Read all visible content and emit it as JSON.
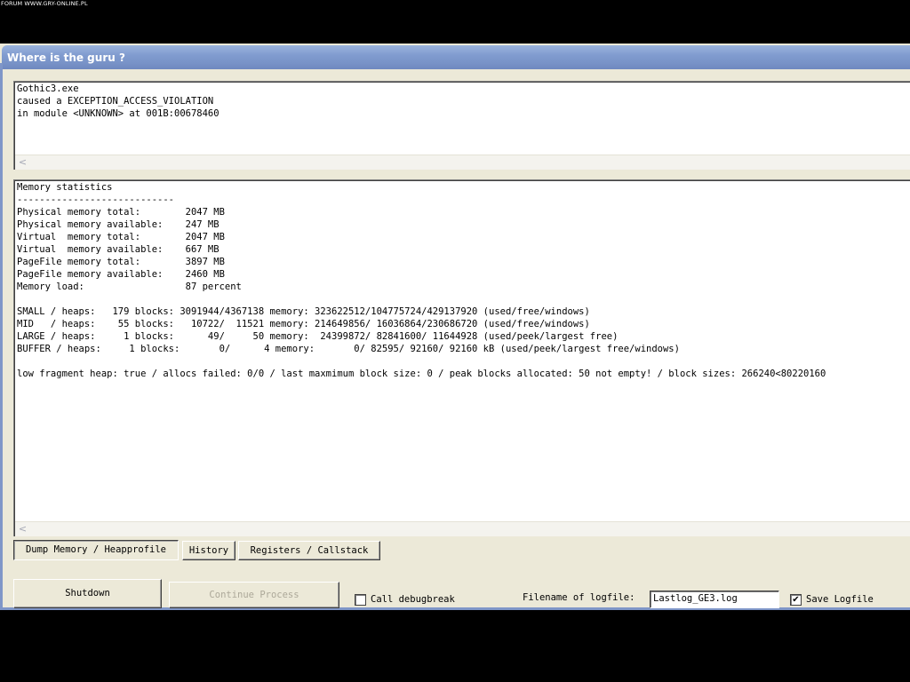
{
  "watermark": "FORUM WWW.GRY-ONLINE.PL",
  "window": {
    "title": "Where is the guru ?"
  },
  "error_box": {
    "text": "Gothic3.exe\ncaused a EXCEPTION_ACCESS_VIOLATION\nin module <UNKNOWN> at 001B:00678460"
  },
  "memory_box": {
    "text": "Memory statistics\n----------------------------\nPhysical memory total:        2047 MB\nPhysical memory available:    247 MB\nVirtual  memory total:        2047 MB\nVirtual  memory available:    667 MB\nPageFile memory total:        3897 MB\nPageFile memory available:    2460 MB\nMemory load:                  87 percent\n\nSMALL / heaps:   179 blocks: 3091944/4367138 memory: 323622512/104775724/429137920 (used/free/windows)\nMID   / heaps:    55 blocks:   10722/  11521 memory: 214649856/ 16036864/230686720 (used/free/windows)\nLARGE / heaps:     1 blocks:      49/     50 memory:  24399872/ 82841600/ 11644928 (used/peek/largest free)\nBUFFER / heaps:     1 blocks:       0/      4 memory:       0/ 82595/ 92160/ 92160 kB (used/peek/largest free/windows)\n\nlow fragment heap: true / allocs failed: 0/0 / last maxmimum block size: 0 / peak blocks allocated: 50 not empty! / block sizes: 266240<80220160"
  },
  "scroll_arrow": "<",
  "tabs": [
    {
      "label": "Dump Memory / Heapprofile",
      "selected": true
    },
    {
      "label": "History",
      "selected": false
    },
    {
      "label": "Registers / Callstack",
      "selected": false
    }
  ],
  "buttons": {
    "shutdown": "Shutdown",
    "continue": "Continue Process"
  },
  "options": {
    "call_debugbreak_label": "Call debugbreak",
    "call_debugbreak_checked": false,
    "logfile_label": "Filename of logfile:",
    "logfile_value": "Lastlog_GE3.log",
    "save_logfile_label": "Save Logfile",
    "save_logfile_checked": true,
    "check_mark": "✔"
  },
  "colors": {
    "titlebar": "#7f96c8",
    "window_bg": "#ece9d8",
    "disabled_text": "#aca899"
  }
}
